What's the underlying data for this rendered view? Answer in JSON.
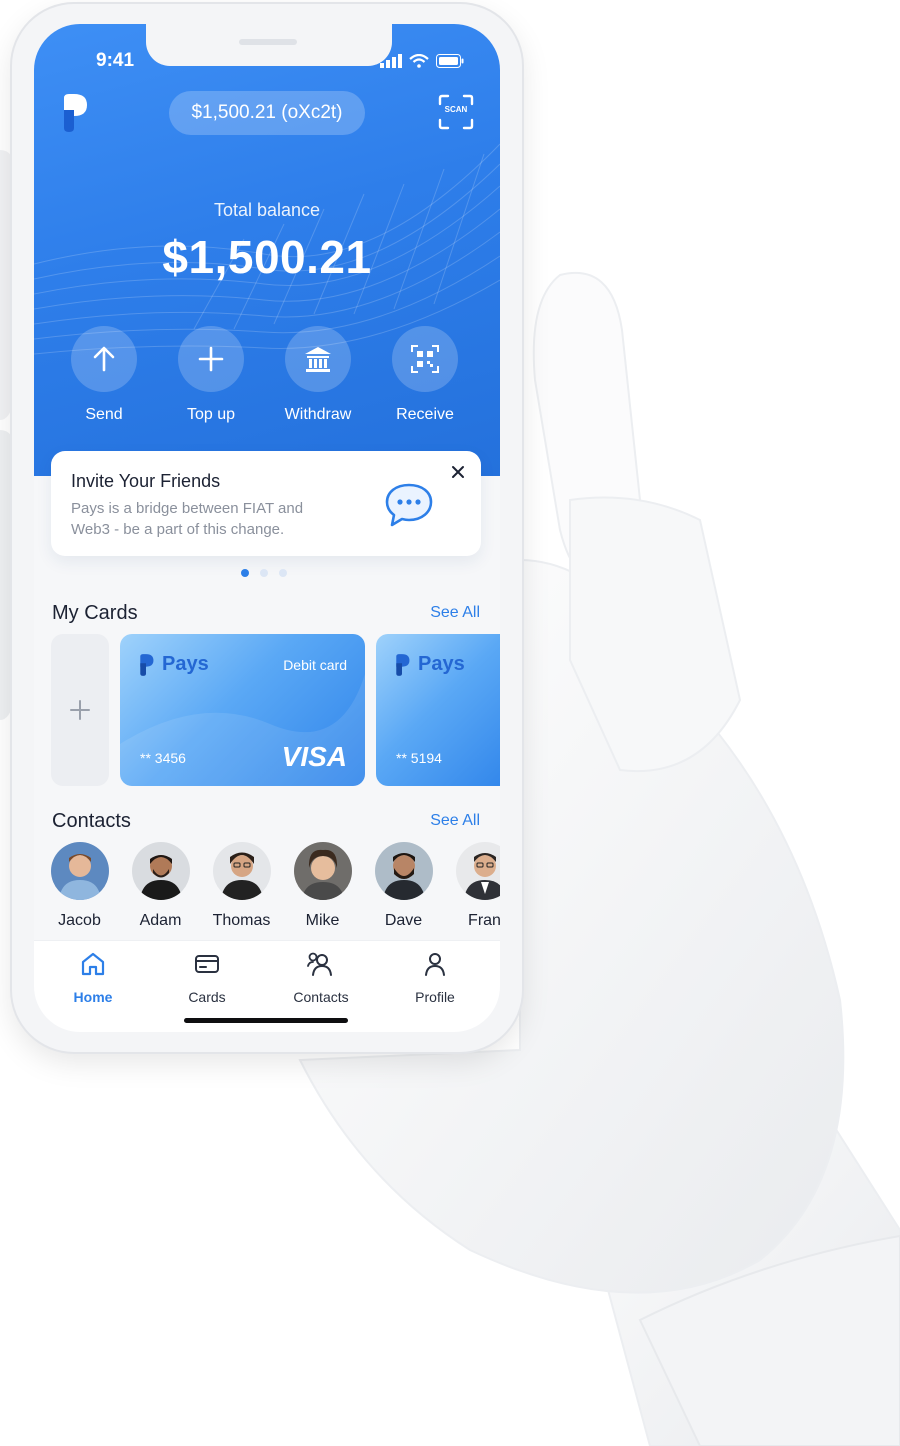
{
  "status_bar": {
    "time": "9:41"
  },
  "header": {
    "wallet_pill": "$1,500.21 (oXc2t)",
    "scan_label": "SCAN"
  },
  "balance": {
    "label": "Total balance",
    "amount": "$1,500.21"
  },
  "actions": [
    {
      "label": "Send",
      "icon": "arrow-up-icon"
    },
    {
      "label": "Top up",
      "icon": "plus-icon"
    },
    {
      "label": "Withdraw",
      "icon": "bank-icon"
    },
    {
      "label": "Receive",
      "icon": "qr-code-icon"
    }
  ],
  "invite": {
    "title": "Invite Your Friends",
    "description": "Pays is a bridge between FIAT and Web3 - be a part of this change."
  },
  "carousel": {
    "pages": 3,
    "active": 0
  },
  "my_cards": {
    "title": "My Cards",
    "see_all": "See All",
    "cards": [
      {
        "brand": "Pays",
        "type": "Debit card",
        "number": "** 3456",
        "network": "VISA"
      },
      {
        "brand": "Pays",
        "number": "** 5194"
      }
    ]
  },
  "contacts": {
    "title": "Contacts",
    "see_all": "See All",
    "people": [
      {
        "name": "Jacob"
      },
      {
        "name": "Adam"
      },
      {
        "name": "Thomas"
      },
      {
        "name": "Mike"
      },
      {
        "name": "Dave"
      },
      {
        "name": "Fran"
      }
    ]
  },
  "tabbar": {
    "items": [
      {
        "label": "Home",
        "icon": "home-icon",
        "active": true
      },
      {
        "label": "Cards",
        "icon": "card-icon",
        "active": false
      },
      {
        "label": "Contacts",
        "icon": "contacts-icon",
        "active": false
      },
      {
        "label": "Profile",
        "icon": "profile-icon",
        "active": false
      }
    ]
  },
  "colors": {
    "accent": "#2d7fe8",
    "hero_top": "#3e8ff5",
    "hero_bottom": "#2471dc"
  }
}
